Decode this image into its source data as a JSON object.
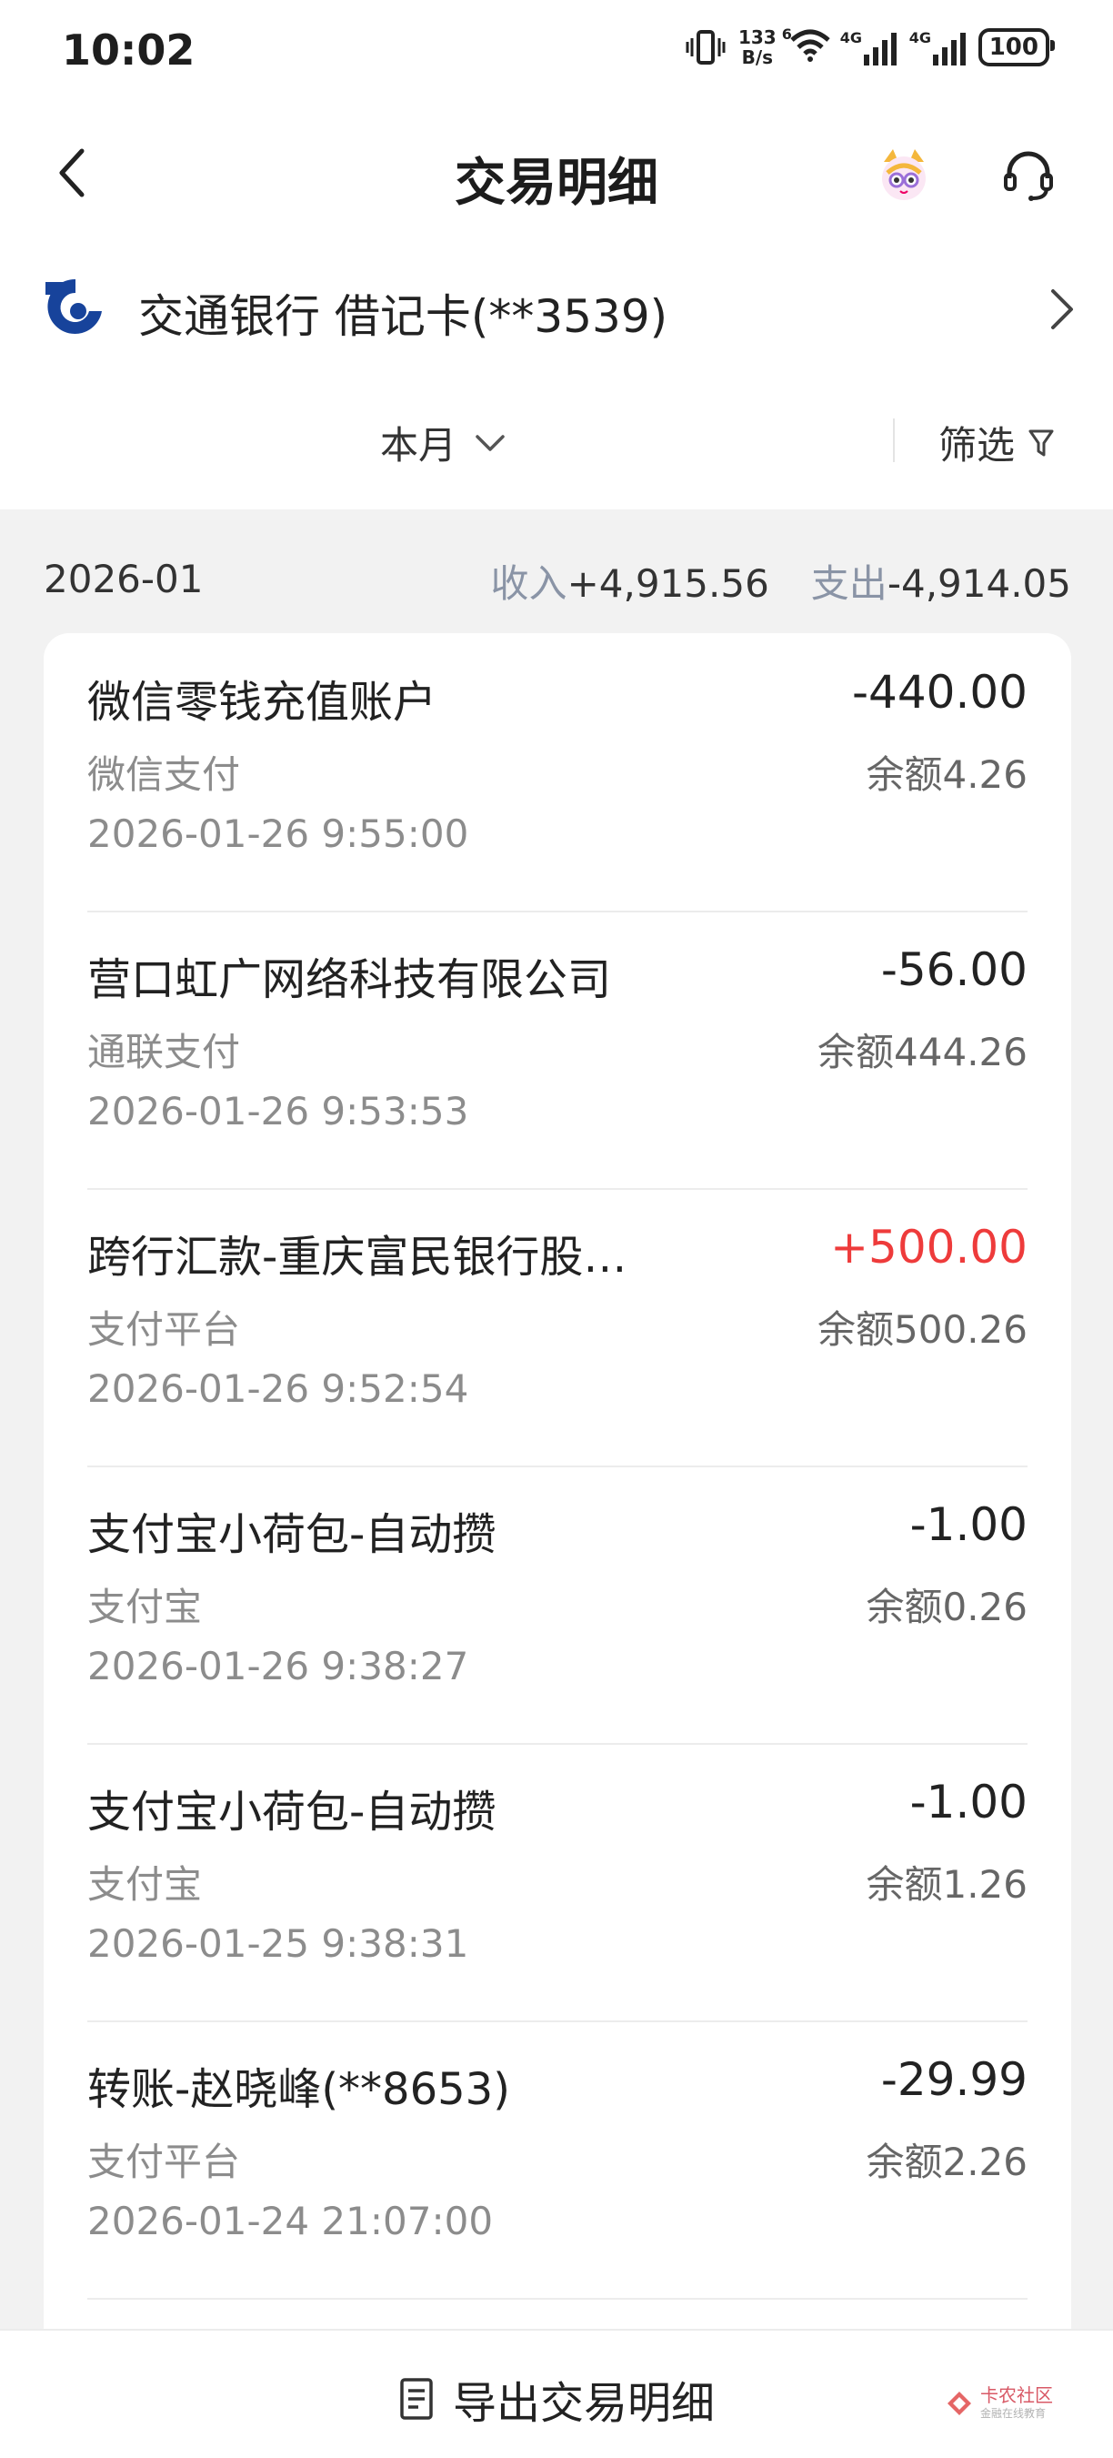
{
  "status_bar": {
    "time": "10:02",
    "net_speed_value": "133",
    "net_speed_unit": "B/s",
    "net_type_1": "4G",
    "net_type_2": "4G",
    "wifi_tag": "6",
    "battery": "100"
  },
  "header": {
    "title": "交易明细",
    "back_icon": "chevron-left-icon",
    "mascot_icon": "mascot-avatar-icon",
    "support_icon": "headset-icon"
  },
  "account": {
    "label": "交通银行 借记卡(**3539)"
  },
  "filters": {
    "month": "本月",
    "filter_label": "筛选"
  },
  "summary": {
    "month": "2026-01",
    "income_label": "收入",
    "income_value": "+4,915.56",
    "expense_label": "支出",
    "expense_value": "-4,914.05"
  },
  "transactions": [
    {
      "name": "微信零钱充值账户",
      "channel": "微信支付",
      "time": "2026-01-26 9:55:00",
      "amount": "-440.00",
      "balance": "余额4.26"
    },
    {
      "name": "营口虹广网络科技有限公司",
      "channel": "通联支付",
      "time": "2026-01-26 9:53:53",
      "amount": "-56.00",
      "balance": "余额444.26"
    },
    {
      "name": "跨行汇款-重庆富民银行股…",
      "channel": "支付平台",
      "time": "2026-01-26 9:52:54",
      "amount": "+500.00",
      "balance": "余额500.26"
    },
    {
      "name": "支付宝小荷包-自动攒",
      "channel": "支付宝",
      "time": "2026-01-26 9:38:27",
      "amount": "-1.00",
      "balance": "余额0.26"
    },
    {
      "name": "支付宝小荷包-自动攒",
      "channel": "支付宝",
      "time": "2026-01-25 9:38:31",
      "amount": "-1.00",
      "balance": "余额1.26"
    },
    {
      "name": "转账-赵晓峰(**8653)",
      "channel": "支付平台",
      "time": "2026-01-24 21:07:00",
      "amount": "-29.99",
      "balance": "余额2.26"
    }
  ],
  "bottom": {
    "export_label": "导出交易明细",
    "watermark": "卡农社区",
    "watermark_sub": "金融在线教育"
  },
  "colors": {
    "income": "#ee3b3b",
    "muted_label": "#8a94a6",
    "bank_logo": "#17439b"
  }
}
